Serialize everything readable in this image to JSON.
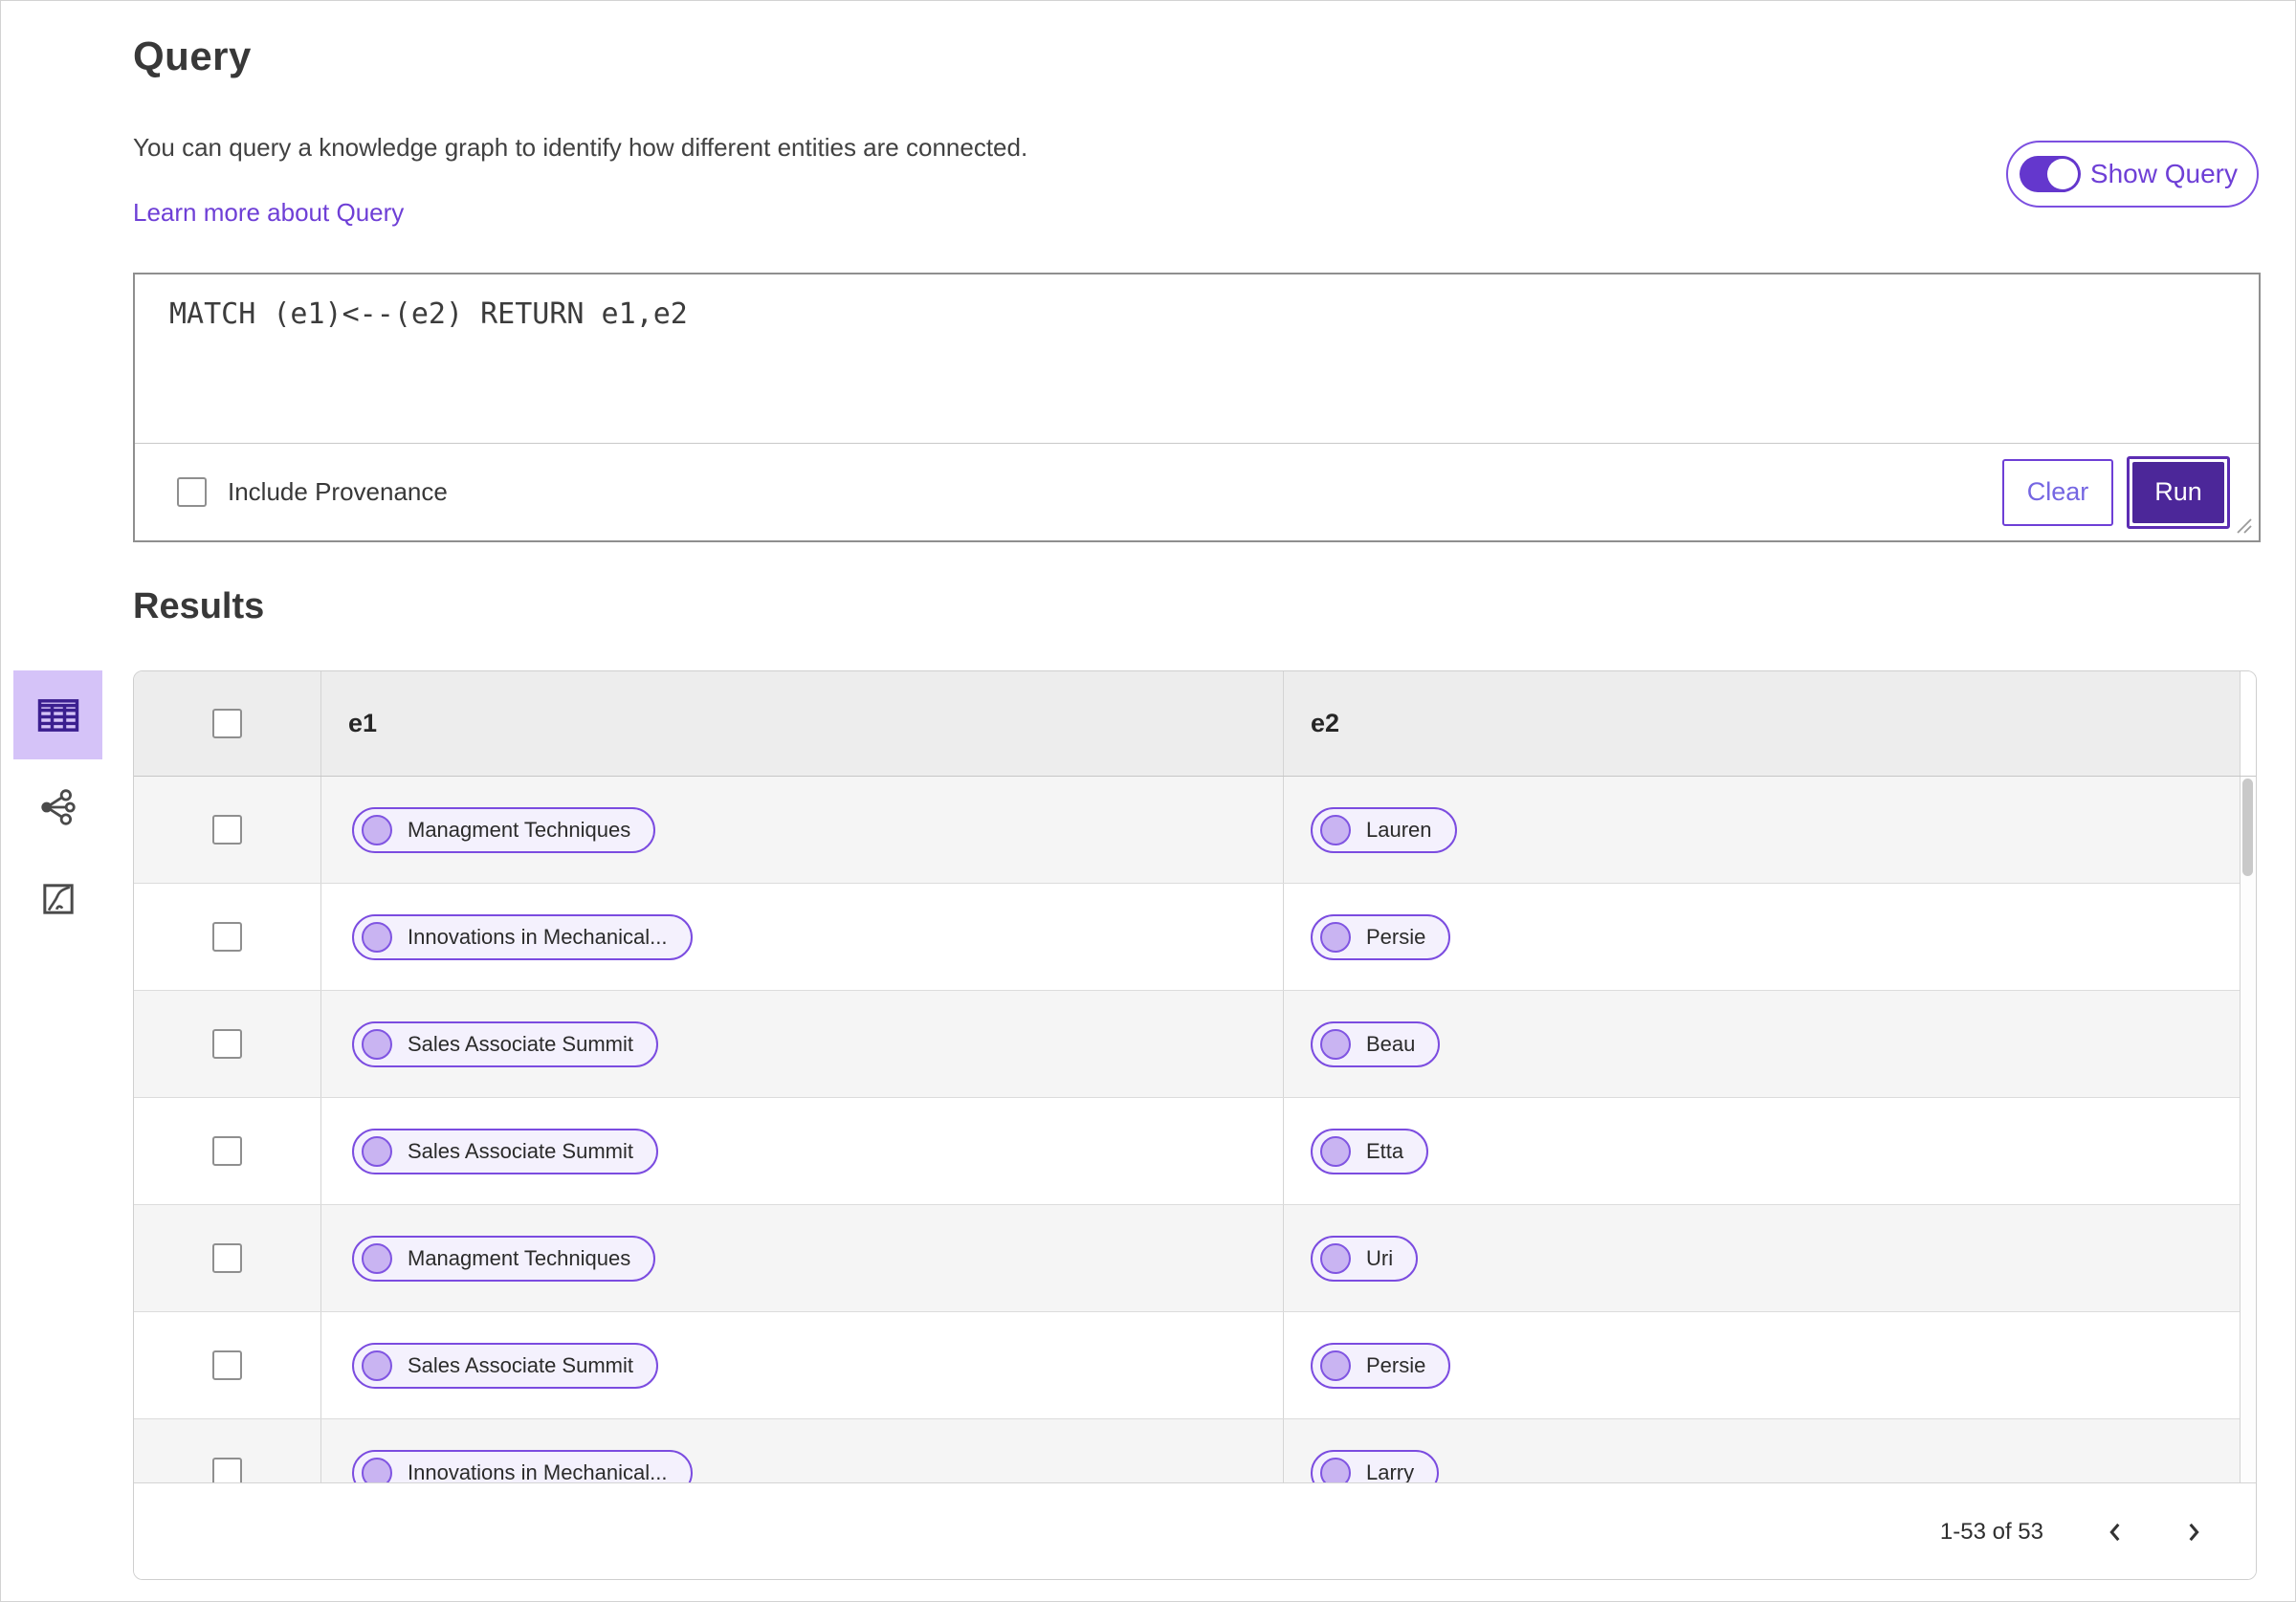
{
  "query": {
    "title": "Query",
    "description": "You can query a knowledge graph to identify how different entities are connected.",
    "learn_more_label": "Learn more about Query",
    "show_query_label": "Show Query",
    "show_query_on": true,
    "editor_value": "MATCH (e1)<--(e2) RETURN e1,e2",
    "include_provenance_label": "Include Provenance",
    "include_provenance_checked": false,
    "clear_label": "Clear",
    "run_label": "Run"
  },
  "results": {
    "heading": "Results",
    "view_switcher": [
      {
        "icon": "table-view-icon",
        "selected": true
      },
      {
        "icon": "graph-view-icon",
        "selected": false
      },
      {
        "icon": "expand-view-icon",
        "selected": false
      }
    ],
    "columns": [
      "e1",
      "e2"
    ],
    "select_all_checked": false,
    "row_checkboxes_checked": false,
    "rows": [
      {
        "e1": "Managment Techniques",
        "e2": "Lauren"
      },
      {
        "e1": "Innovations in Mechanical...",
        "e2": "Persie"
      },
      {
        "e1": "Sales Associate Summit",
        "e2": "Beau"
      },
      {
        "e1": "Sales Associate Summit",
        "e2": "Etta"
      },
      {
        "e1": "Managment Techniques",
        "e2": "Uri"
      },
      {
        "e1": "Sales Associate Summit",
        "e2": "Persie"
      },
      {
        "e1": "Innovations in Mechanical...",
        "e2": "Larry"
      }
    ],
    "pagination": {
      "range_label": "1-53 of 53",
      "prev_icon": "chevron-left-icon",
      "next_icon": "chevron-right-icon"
    }
  },
  "colors": {
    "primary_button": "#4c2799",
    "toggle_track": "#6437cd",
    "link": "#6e3fd6",
    "pill_border": "#7b4ce0",
    "pill_background": "#f4f1fd",
    "pill_node_fill": "#c9b4f2",
    "selected_tile": "#d5c3f8",
    "table_header_bg": "#ededed",
    "row_alt_bg": "#f5f5f5"
  }
}
